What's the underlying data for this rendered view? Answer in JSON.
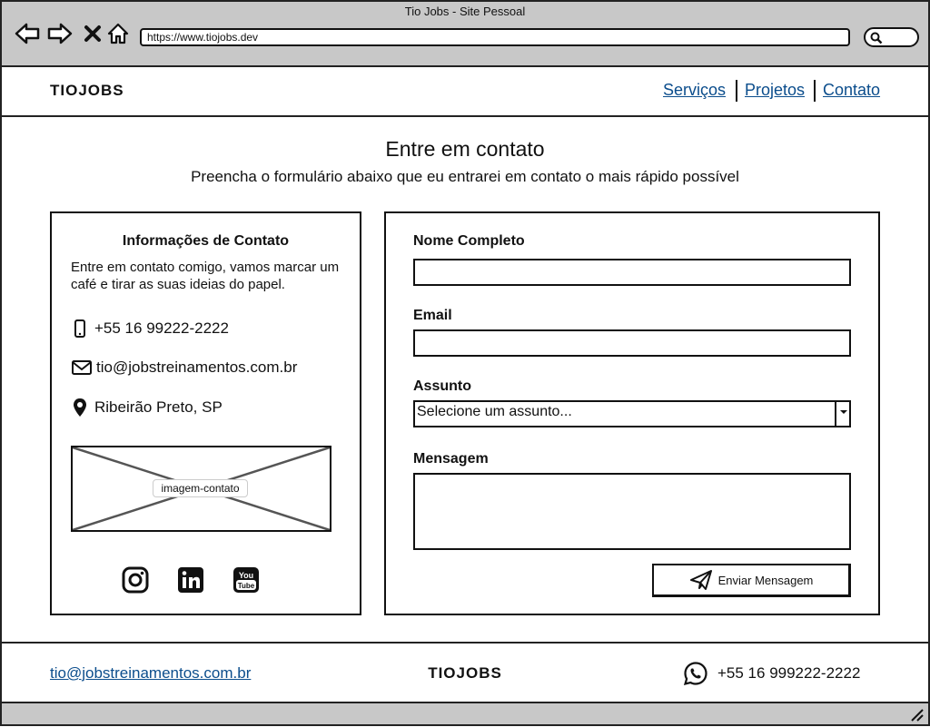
{
  "window": {
    "title": "Tio Jobs - Site Pessoal"
  },
  "browser": {
    "url": "https://www.tiojobs.dev",
    "back_icon": "back-arrow-icon",
    "forward_icon": "forward-arrow-icon",
    "close_icon": "close-icon",
    "home_icon": "home-icon",
    "search_icon": "search-icon"
  },
  "header": {
    "brand": "TIOJOBS",
    "nav": [
      {
        "label": "Serviços"
      },
      {
        "label": "Projetos"
      },
      {
        "label": "Contato"
      }
    ]
  },
  "main": {
    "title": "Entre em contato",
    "subtitle": "Preencha o formulário abaixo que eu entrarei em contato o mais rápido possível"
  },
  "contact_info": {
    "title": "Informações de Contato",
    "description": "Entre em contato comigo, vamos marcar um café e tirar as suas ideias do papel.",
    "phone": "+55 16 99222-2222",
    "email": "tio@jobstreinamentos.com.br",
    "location": "Ribeirão Preto, SP",
    "image_label": "imagem-contato",
    "social_icons": [
      "instagram-icon",
      "linkedin-icon",
      "youtube-icon"
    ]
  },
  "form": {
    "name_label": "Nome Completo",
    "name_value": "",
    "email_label": "Email",
    "email_value": "",
    "subject_label": "Assunto",
    "subject_selected": "Selecione um assunto...",
    "message_label": "Mensagem",
    "message_value": "",
    "submit_label": "Enviar Mensagem"
  },
  "footer": {
    "email": "tio@jobstreinamentos.com.br",
    "brand": "TIOJOBS",
    "phone": "+55 16 999222-2222"
  },
  "colors": {
    "link": "#0b4d8c",
    "chrome": "#c8c8c8",
    "border": "#111111"
  }
}
